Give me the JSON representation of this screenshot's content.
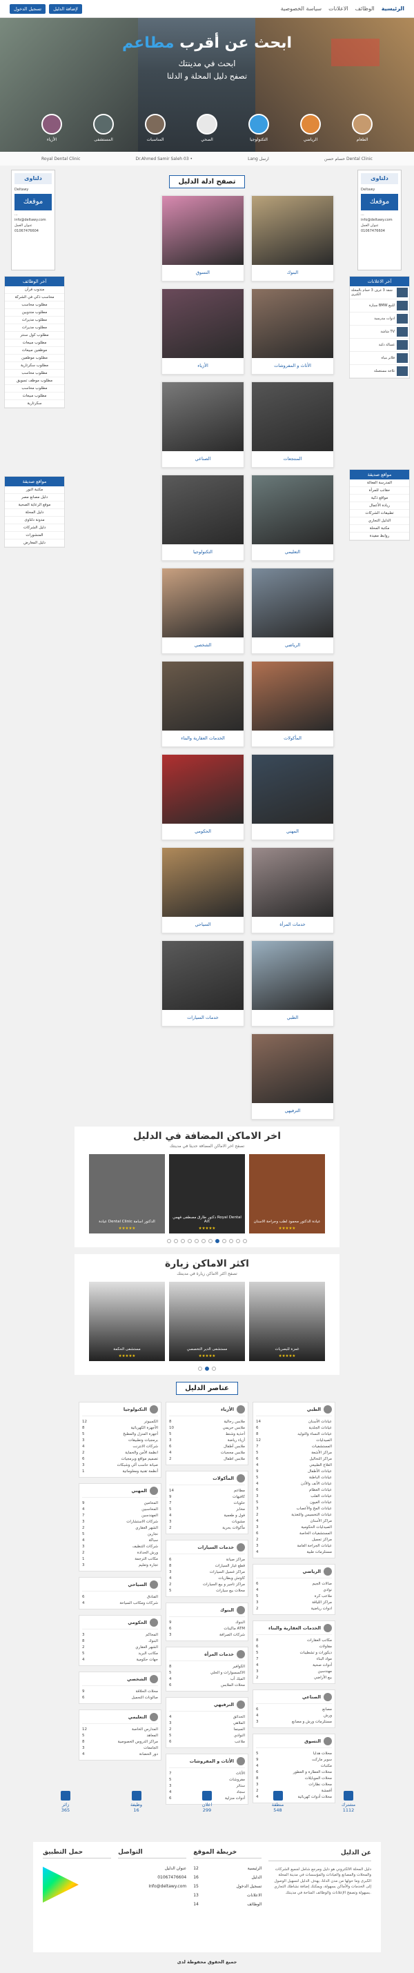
{
  "topnav": [
    "الرئيسية",
    "الوظائف",
    "الاعلانات",
    "سياسة الخصوصية"
  ],
  "btn_add": "لإضافة الدليل",
  "btn_login": "تسجيل الدخول",
  "hero": {
    "title_pre": "ابحث عن أقرب ",
    "title_acc": "مطاعم",
    "sub1": "ابحث في مدينتك",
    "sub2": "تصفح دليل المحلة و الدلتا"
  },
  "hero_cats": [
    "الطعام",
    "الرياضي",
    "التكنولوجيا",
    "الصحي",
    "المناسبات",
    "المستشفى",
    "الأزياء"
  ],
  "crumbs": [
    "Royal Dental Clinic",
    "Dr.Ahmed Samir Saleh 03 •",
    "Lang ارسل",
    "حسام حسن Dental Clinic"
  ],
  "ad": {
    "logo": "دلتاوى",
    "sub": "Deltawy",
    "mawqa": "موقعك",
    "lines": [
      "...",
      "info@deltawy.com",
      "عنوان العمل",
      "01067476604"
    ]
  },
  "jobs_box": {
    "title": "آخر الوظائف",
    "items": [
      "مندوب قرآن",
      "محاسب ذكي في الشركة",
      "مطلوب محاسب",
      "مطلوب مندوبين",
      "مطلوب مديرات",
      "مطلوب مديرات",
      "مطلوب كول سنتر",
      "مطلوب مبيعات",
      "موظفين مبيعات",
      "مطلوب موظفين",
      "مطلوب سكرتارية",
      "مطلوب محاسب",
      "مطلوب موظف تسويق",
      "مطلوب محاسب",
      "مطلوب مبيعات",
      "سكرتارية"
    ]
  },
  "ads_box": {
    "title": "آخر الاعلانات",
    "items": [
      "شقة 3 غرف 3 حمام بالمحلة الكبرى",
      "سيارة BMW للبيع",
      "ادوات مدرسية",
      "شاشة TV",
      "غسالة ذكية",
      "فلاتر مياه",
      "ثلاجة مستعملة"
    ]
  },
  "sites_left": {
    "title": "مواقع صديقة",
    "items": [
      "مكتبة النور",
      "دليل مصانع مصر",
      "موقع الرعاية الصحية",
      "دليل المحلة",
      "مدونة دلتاوى",
      "دليل الشركات",
      "المنشورات",
      "دليل المعارض"
    ]
  },
  "sites_right": {
    "title": "مواقع صديقة",
    "items": [
      "المدرسة الفعالة",
      "حقائب للمرأة",
      "مواقع ذكية",
      "ريادة الأعمال",
      "تطبيقات الشركات",
      "الدليل التجاري",
      "مكتبة المحلة",
      "روابط مفيدة"
    ]
  },
  "browse_title": "تصفح ادلة الدليل",
  "cards": [
    "البنوك",
    "التسوق",
    "الأثاث و المفروشات",
    "الأزياء",
    "المنتجعات",
    "الصناعي",
    "التعليمي",
    "التكنولوجيا",
    "الرياضي",
    "الشخصي",
    "المأكولات",
    "الخدمات العقارية والبناء",
    "المهني",
    "الحكومي",
    "خدمات المرأة",
    "السياحي",
    "الطبي",
    "خدمات السيارات",
    "الترفيهي"
  ],
  "recent": {
    "title": "اخر الاماكن المضافة في الدليل",
    "sub": "تصفح اخر الاماكن المضافة حديثا في مدينتك",
    "items": [
      "عيادة الدكتور محمود لطب وجراحة الاسنان",
      "دكتور طارق مصطفى فهمي Royal Dental Art",
      "عيادة Dental Clinic الدكتور اسامة"
    ]
  },
  "visited": {
    "title": "اكثر الاماكن زيارة",
    "sub": "تصفح اكثر الاماكن زيارة في مدينتك",
    "items": [
      "غمزة للبصريات",
      "مستشفى الدير التخصصي",
      "مستشفى الحكمة"
    ]
  },
  "elements_title": "عناصر الدليل",
  "el_col1": [
    {
      "h": "التكنولوجيا",
      "r": [
        [
          "الكمبيوتر",
          "12"
        ],
        [
          "الأجهزة الكهربائية",
          "8"
        ],
        [
          "أجهزة المنزل والمطبخ",
          "5"
        ],
        [
          "برمجيات وتطبيقات",
          "3"
        ],
        [
          "شركات الانترنت",
          "4"
        ],
        [
          "انظمة الأمن والحماية",
          "2"
        ],
        [
          "تصميم مواقع وبرمجيات",
          "6"
        ],
        [
          "صيانة حاسب آلي وشبكات",
          "3"
        ],
        [
          "أنظمة تقنية ومعلوماتية",
          "1"
        ]
      ]
    },
    {
      "h": "المهني",
      "r": [
        [
          "المحامين",
          "9"
        ],
        [
          "المحاسبين",
          "4"
        ],
        [
          "المهندسين",
          "7"
        ],
        [
          "شركات الاستشارات",
          "3"
        ],
        [
          "الشهر العقاري",
          "2"
        ],
        [
          "نجارين",
          "5"
        ],
        [
          "سباكة",
          "4"
        ],
        [
          "شركات التنظيف",
          "3"
        ],
        [
          "ورش الحدادة",
          "2"
        ],
        [
          "مكاتب الترجمة",
          "1"
        ],
        [
          "تجارة وتعليم",
          "3"
        ]
      ]
    },
    {
      "h": "السياحي",
      "r": [
        [
          "الفنادق",
          "6"
        ],
        [
          "شركات ومكاتب السياحة",
          "4"
        ]
      ]
    },
    {
      "h": "الحكومي",
      "r": [
        [
          "المحاكم",
          "3"
        ],
        [
          "البنوك",
          "8"
        ],
        [
          "الشهر العقاري",
          "2"
        ],
        [
          "مكاتب البريد",
          "5"
        ],
        [
          "جهات حكومية",
          "4"
        ]
      ]
    },
    {
      "h": "الشخصي",
      "r": [
        [
          "محلات الحلاقة",
          "9"
        ],
        [
          "صالونات التجميل",
          "6"
        ]
      ]
    },
    {
      "h": "التعليمي",
      "r": [
        [
          "المدارس الخاصة",
          "12"
        ],
        [
          "المعاهد",
          "5"
        ],
        [
          "مراكز الدروس الخصوصية",
          "8"
        ],
        [
          "الجامعات",
          "3"
        ],
        [
          "دور الحضانة",
          "4"
        ]
      ]
    }
  ],
  "el_col2": [
    {
      "h": "الأزياء",
      "r": [
        [
          "ملابس رجالية",
          "8"
        ],
        [
          "ملابس حريمي",
          "10"
        ],
        [
          "أحذية وشنط",
          "5"
        ],
        [
          "أزياء رياضة",
          "3"
        ],
        [
          "ملابس أطفال",
          "6"
        ],
        [
          "ملابس محجبات",
          "4"
        ],
        [
          "ملابس اطفال",
          "2"
        ]
      ]
    },
    {
      "h": "المأكولات",
      "r": [
        [
          "مطاعم",
          "14"
        ],
        [
          "كافيهات",
          "9"
        ],
        [
          "حلويات",
          "7"
        ],
        [
          "مخابز",
          "5"
        ],
        [
          "فول و طعمية",
          "4"
        ],
        [
          "مشويات",
          "3"
        ],
        [
          "مأكولات بحرية",
          "2"
        ]
      ]
    },
    {
      "h": "خدمات السيارات",
      "r": [
        [
          "مراكز صيانة",
          "6"
        ],
        [
          "قطع غيار السيارات",
          "8"
        ],
        [
          "مراكز غسيل السيارات",
          "3"
        ],
        [
          "كاوتش وبطاريات",
          "4"
        ],
        [
          "مراكز تاجير و بيع السيارات",
          "2"
        ],
        [
          "محلات بيع سيارات",
          "5"
        ]
      ]
    },
    {
      "h": "البنوك",
      "r": [
        [
          "البنوك",
          "9"
        ],
        [
          "ماكينات ATM",
          "6"
        ],
        [
          "شركات الصرافة",
          "3"
        ]
      ]
    },
    {
      "h": "خدمات المرأة",
      "r": [
        [
          "الكوافير",
          "8"
        ],
        [
          "الاكسسوارات و الحلي",
          "5"
        ],
        [
          "الميك أب",
          "4"
        ],
        [
          "محلات الملابس",
          "6"
        ]
      ]
    },
    {
      "h": "الترفيهي",
      "r": [
        [
          "الحدائق",
          "4"
        ],
        [
          "الملاهي",
          "3"
        ],
        [
          "السينما",
          "2"
        ],
        [
          "النوادي",
          "5"
        ],
        [
          "ملاعب",
          "6"
        ]
      ]
    },
    {
      "h": "الأثاث و المفروشات",
      "r": [
        [
          "الأثاث",
          "7"
        ],
        [
          "مفروشات",
          "5"
        ],
        [
          "ستائر",
          "3"
        ],
        [
          "سجاد",
          "4"
        ],
        [
          "أدوات منزلية",
          "6"
        ]
      ]
    }
  ],
  "el_col3": [
    {
      "h": "الطبي",
      "r": [
        [
          "عيادات الأسنان",
          "14"
        ],
        [
          "عيادات الجلدية",
          "6"
        ],
        [
          "عيادات النساء والتوليد",
          "8"
        ],
        [
          "الصيدليات",
          "12"
        ],
        [
          "المستشفيات",
          "7"
        ],
        [
          "مراكز الأشعة",
          "5"
        ],
        [
          "مراكز التحاليل",
          "6"
        ],
        [
          "العلاج الطبيعي",
          "4"
        ],
        [
          "عيادات الأطفال",
          "9"
        ],
        [
          "عيادات الباطنة",
          "5"
        ],
        [
          "عيادات الأنف والأذن",
          "4"
        ],
        [
          "عيادات العظام",
          "6"
        ],
        [
          "عيادات القلب",
          "3"
        ],
        [
          "عيادات العيون",
          "5"
        ],
        [
          "عيادات المخ والأعصاب",
          "3"
        ],
        [
          "عيادات التخسيس والتغذية",
          "2"
        ],
        [
          "مراكز الأسنان",
          "4"
        ],
        [
          "الصيدليات الحكومية",
          "3"
        ],
        [
          "المستشفيات الخاصة",
          "6"
        ],
        [
          "مراكز تجميل",
          "2"
        ],
        [
          "عيادات الجراحة العامة",
          "3"
        ],
        [
          "مستلزمات طبية",
          "4"
        ]
      ]
    },
    {
      "h": "الرياضي",
      "r": [
        [
          "صالات الجيم",
          "6"
        ],
        [
          "نوادي",
          "4"
        ],
        [
          "ملاعب كرة",
          "5"
        ],
        [
          "مراكز اللياقة",
          "3"
        ],
        [
          "ادوات رياضية",
          "2"
        ]
      ]
    },
    {
      "h": "الخدمات العقارية والبناء",
      "r": [
        [
          "مكاتب العقارات",
          "8"
        ],
        [
          "مقاولات",
          "6"
        ],
        [
          "ديكورات و تشطيبات",
          "5"
        ],
        [
          "مواد البناء",
          "7"
        ],
        [
          "أدوات صحية",
          "4"
        ],
        [
          "مهندسين",
          "3"
        ],
        [
          "بيع الأراضي",
          "2"
        ]
      ]
    },
    {
      "h": "الصناعي",
      "r": [
        [
          "مصانع",
          "6"
        ],
        [
          "ورش",
          "4"
        ],
        [
          "مستلزمات ورش و مصانع",
          "3"
        ]
      ]
    },
    {
      "h": "التسوق",
      "r": [
        [
          "محلات هدايا",
          "5"
        ],
        [
          "سوبر ماركت",
          "9"
        ],
        [
          "مكتبات",
          "4"
        ],
        [
          "محلات العطارة و العطور",
          "6"
        ],
        [
          "محلات الموبايلات",
          "8"
        ],
        [
          "محلات نظارات",
          "3"
        ],
        [
          "أقمشة",
          "2"
        ],
        [
          "محلات أدوات كهربائية",
          "4"
        ]
      ]
    }
  ],
  "stats": [
    {
      "label": "مشترك",
      "value": "1112"
    },
    {
      "label": "منطقة",
      "value": "548"
    },
    {
      "label": "اعلان",
      "value": "299"
    },
    {
      "label": "وظيفة",
      "value": "16"
    },
    {
      "label": "زائر",
      "value": "365"
    }
  ],
  "footer": {
    "about_title": "عن الدليل",
    "about_text": "دليل المحلة الالكتروني هو دليل ومرجع شامل لجميع الشركات والمحلات والمصانع والعيادات والمؤسسات في مدينة المحلة الكبرى وما حولها من مدن الدلتا، يهدف الدليل لتسهيل الوصول إلى الخدمات والأماكن بسهولة، ويمكنك إضافة نشاطك التجاري بسهولة وتصفح الإعلانات والوظائف المتاحة في مدينتك.",
    "map_title": "خريطة الموقع",
    "map_links": [
      "الرئيسية",
      "الدليل",
      "تسجيل الدخول",
      "الاعلانات",
      "الوظائف"
    ],
    "map_nums": [
      "12",
      "16",
      "15",
      "13",
      "14"
    ],
    "contact_title": "التواصل",
    "contact": [
      "عنوان الدليل",
      "01067476604",
      "Info@deltawy.com"
    ],
    "app_title": "حمل التطبيق",
    "copyright": "جميع الحقوق محفوظة لدى"
  }
}
